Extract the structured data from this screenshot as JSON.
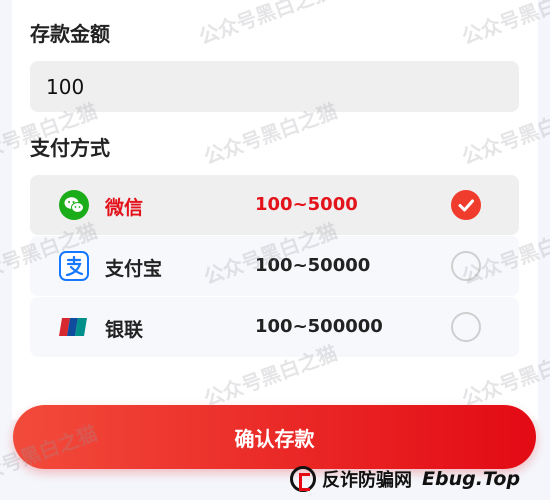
{
  "deposit": {
    "amount_title": "存款金额",
    "amount_value": "100",
    "method_title": "支付方式",
    "methods": [
      {
        "name": "微信",
        "range": "100~5000",
        "selected": true,
        "icon": "wechat-icon",
        "color": "#1aad19"
      },
      {
        "name": "支付宝",
        "range": "100~50000",
        "selected": false,
        "icon": "alipay-icon",
        "color": "#1677ff"
      },
      {
        "name": "银联",
        "range": "100~500000",
        "selected": false,
        "icon": "unionpay-icon",
        "color": "#d7282f"
      }
    ],
    "confirm_label": "确认存款"
  },
  "watermark": "公众号黑白之猫",
  "footer": {
    "brand": "反诈防骗网",
    "site": "Ebug.Top"
  },
  "colors": {
    "accent": "#e30a14",
    "selected_bg": "#efefef",
    "row_bg": "#f7f8fc"
  }
}
